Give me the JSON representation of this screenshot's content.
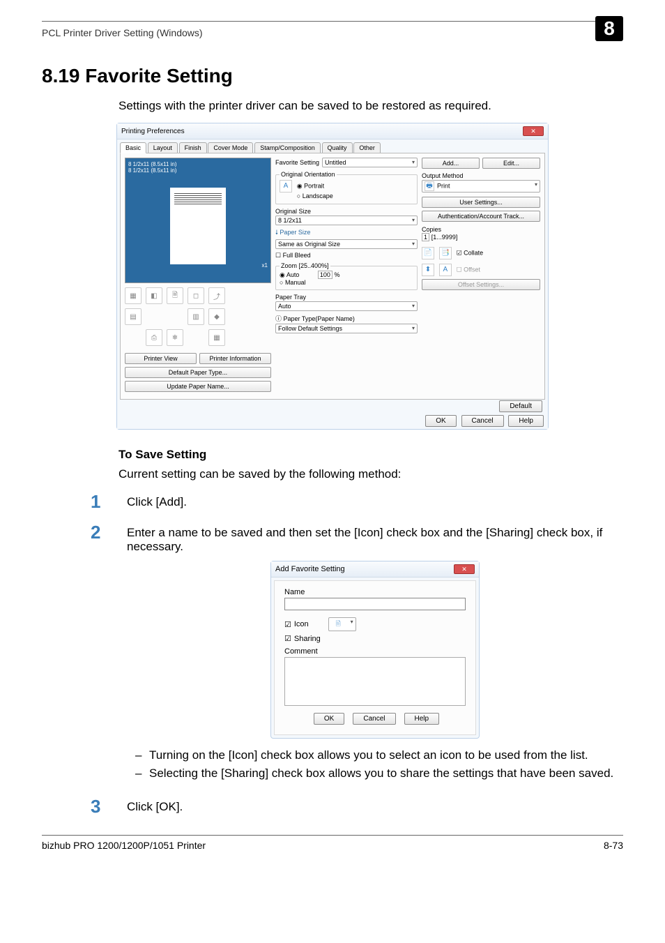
{
  "header": {
    "left": "PCL Printer Driver Setting (Windows)",
    "chapter": "8"
  },
  "section_title": "8.19    Favorite Setting",
  "intro": "Settings with the printer driver can be saved to be restored as required.",
  "dlg": {
    "title": "Printing Preferences",
    "tabs": [
      "Basic",
      "Layout",
      "Finish",
      "Cover Mode",
      "Stamp/Composition",
      "Quality",
      "Other"
    ],
    "preview_line1": "8 1/2x11 (8.5x11 in)",
    "preview_line2": "8 1/2x11 (8.5x11 in)",
    "preview_corner": "x1",
    "btn_printer_view": "Printer View",
    "btn_printer_info": "Printer Information",
    "btn_def_paper_type": "Default Paper Type...",
    "btn_upd_paper_name": "Update Paper Name...",
    "fav_label": "Favorite Setting",
    "fav_value": "Untitled",
    "btn_add": "Add...",
    "btn_edit": "Edit...",
    "grp_orient": "Original Orientation",
    "orient_portrait": "Portrait",
    "orient_landscape": "Landscape",
    "lbl_orig_size": "Original Size",
    "orig_size": "8 1/2x11",
    "lbl_paper_size": "Paper Size",
    "paper_size": "Same as Original Size",
    "chk_full_bleed": "Full Bleed",
    "grp_zoom": "Zoom [25..400%]",
    "zoom_auto": "Auto",
    "zoom_manual": "Manual",
    "zoom_value": "100",
    "zoom_suffix": "%",
    "lbl_paper_tray": "Paper Tray",
    "paper_tray": "Auto",
    "lbl_paper_type": "Paper Type(Paper Name)",
    "paper_type_sel": "Follow Default Settings",
    "lbl_output_method": "Output Method",
    "output_method": "Print",
    "btn_user_settings": "User Settings...",
    "btn_auth": "Authentication/Account Track...",
    "lbl_copies": "Copies",
    "copies": "1",
    "copies_range": "[1...9999]",
    "chk_collate": "Collate",
    "chk_offset": "Offset",
    "btn_offset_settings": "Offset Settings...",
    "btn_default": "Default",
    "btn_ok": "OK",
    "btn_cancel": "Cancel",
    "btn_help": "Help"
  },
  "sub_title": "To Save Setting",
  "sub_intro": "Current setting can be saved by the following method:",
  "steps": {
    "1": "Click [Add].",
    "2": "Enter a name to be saved and then set the [Icon] check box and the [Sharing] check box, if necessary.",
    "3": "Click [OK]."
  },
  "small": {
    "title": "Add Favorite Setting",
    "name_label": "Name",
    "icon_label": "Icon",
    "sharing_label": "Sharing",
    "comment_label": "Comment",
    "ok": "OK",
    "cancel": "Cancel",
    "help": "Help"
  },
  "bullets": {
    "a": "Turning on the [Icon] check box allows you to select an icon to be used from the list.",
    "b": "Selecting the [Sharing] check box allows you to share the settings that have been saved."
  },
  "footer": {
    "left": "bizhub PRO 1200/1200P/1051 Printer",
    "right": "8-73"
  }
}
